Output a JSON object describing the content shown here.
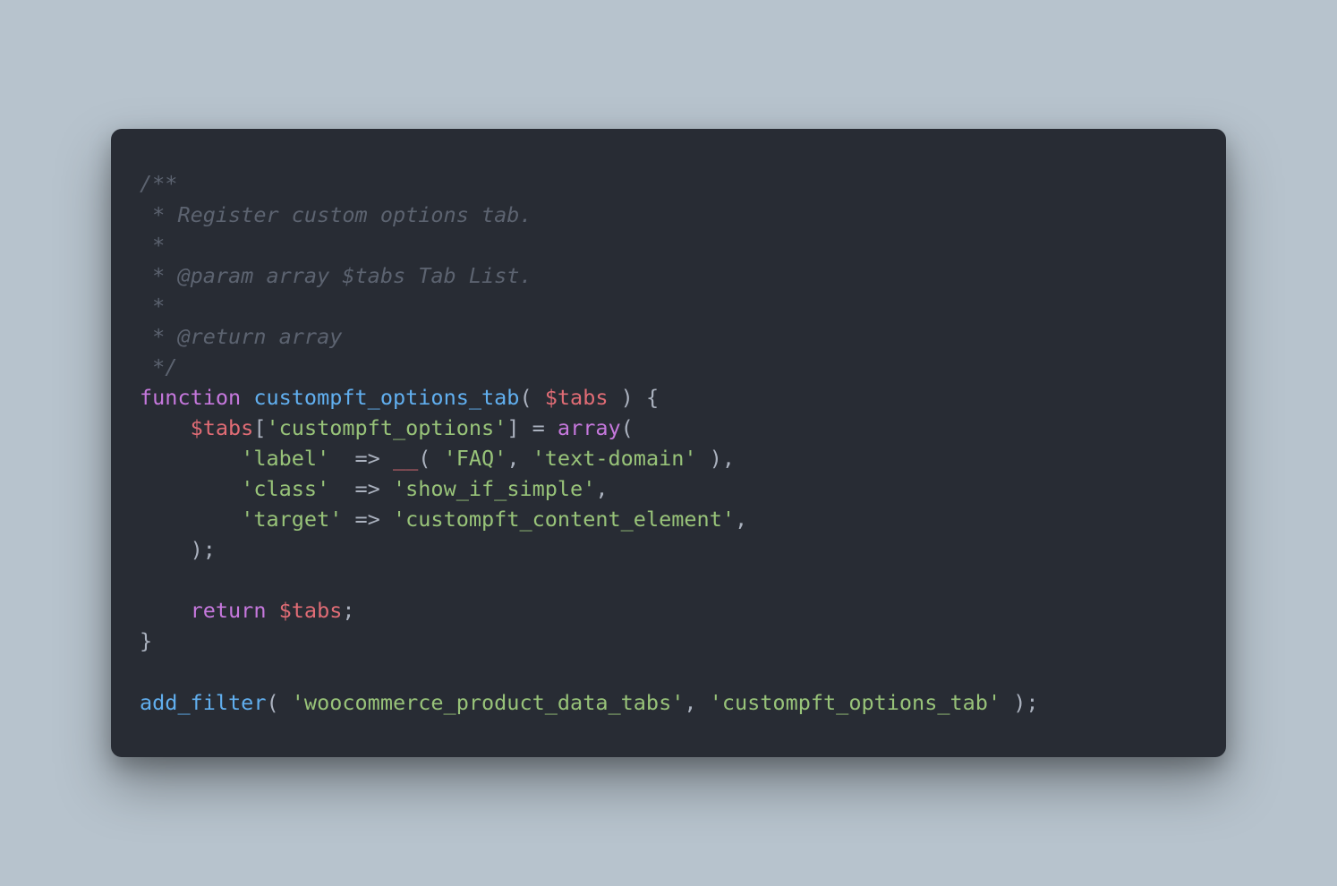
{
  "code": {
    "c1": "/**",
    "c2": " * Register custom options tab.",
    "c3": " *",
    "c4": " * @param array $tabs Tab List.",
    "c5": " *",
    "c6": " * @return array",
    "c7": " */",
    "kw_function": "function",
    "fn_name": "custompft_options_tab",
    "paren_open": "( ",
    "var_tabs1": "$tabs",
    "paren_close_brace": " ) {",
    "indent1": "    ",
    "var_tabs2": "$tabs",
    "bracket_open": "[",
    "str_key_options": "'custompft_options'",
    "bracket_close_eq": "] = ",
    "kw_array": "array",
    "paren_only": "(",
    "indent2": "        ",
    "str_label": "'label'",
    "pad_label": "  ",
    "arrow": "=>",
    "space": " ",
    "fn_underscore": "__",
    "paren_open2": "( ",
    "str_faq": "'FAQ'",
    "comma": ", ",
    "str_textdomain": "'text-domain'",
    "paren_close_comma": " ),",
    "str_class": "'class'",
    "pad_class": "  ",
    "str_showif": "'show_if_simple'",
    "trailing_comma": ",",
    "str_target": "'target'",
    "pad_target": " ",
    "str_content": "'custompft_content_element'",
    "close_array": "    );",
    "kw_return": "return",
    "var_tabs3": "$tabs",
    "semi": ";",
    "close_brace": "}",
    "fn_addfilter": "add_filter",
    "str_hook": "'woocommerce_product_data_tabs'",
    "str_callback": "'custompft_options_tab'",
    "paren_close_semi": " );"
  }
}
